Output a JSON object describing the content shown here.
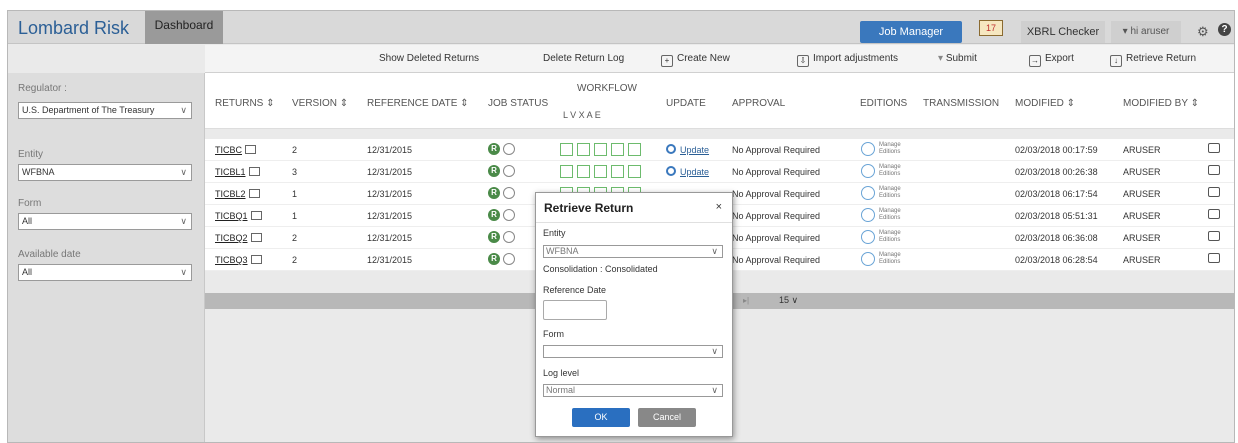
{
  "app": {
    "brand": "Lombard Risk",
    "dashboard_tab": "Dashboard"
  },
  "topbar": {
    "job_manager": "Job Manager",
    "calendar_badge": "17",
    "xbrl_checker": "XBRL Checker",
    "user": "hi aruser",
    "settings_icon": "gear-icon",
    "help_icon": "help-icon"
  },
  "toolbar": {
    "show_deleted": "Show Deleted Returns",
    "delete_log": "Delete Return Log",
    "create_new": "Create New",
    "import_adjustments": "Import adjustments",
    "submit": "Submit",
    "export": "Export",
    "retrieve_return": "Retrieve Return"
  },
  "sidebar": {
    "regulator_label": "Regulator :",
    "regulator_value": "U.S. Department of The Treasury",
    "entity_label": "Entity",
    "entity_value": "WFBNA",
    "form_label": "Form",
    "form_value": "All",
    "date_label": "Available date",
    "date_value": "All"
  },
  "table": {
    "headers": {
      "returns": "RETURNS ⇕",
      "version": "VERSION ⇕",
      "reference_date": "REFERENCE DATE ⇕",
      "job_status": "JOB STATUS",
      "workflow": "WORKFLOW",
      "workflow_sub": "L  V  X  A  E",
      "update": "UPDATE",
      "approval": "APPROVAL",
      "editions": "EDITIONS",
      "transmission": "TRANSMISSION",
      "modified": "MODIFIED ⇕",
      "modified_by": "MODIFIED BY ⇕"
    },
    "rows": [
      {
        "ret": "TICBC",
        "ver": "2",
        "date": "12/31/2015",
        "status": "R",
        "update": "Update",
        "approval": "No Approval Required",
        "ed1": "Manage",
        "ed2": "Editions",
        "mod": "02/03/2018 00:17:59",
        "by": "ARUSER"
      },
      {
        "ret": "TICBL1",
        "ver": "3",
        "date": "12/31/2015",
        "status": "R",
        "update": "Update",
        "approval": "No Approval Required",
        "ed1": "Manage",
        "ed2": "Editions",
        "mod": "02/03/2018 00:26:38",
        "by": "ARUSER"
      },
      {
        "ret": "TICBL2",
        "ver": "1",
        "date": "12/31/2015",
        "status": "R",
        "update": "",
        "approval": "No Approval Required",
        "ed1": "Manage",
        "ed2": "Editions",
        "mod": "02/03/2018 06:17:54",
        "by": "ARUSER"
      },
      {
        "ret": "TICBQ1",
        "ver": "1",
        "date": "12/31/2015",
        "status": "R",
        "update": "",
        "approval": "No Approval Required",
        "ed1": "Manage",
        "ed2": "Editions",
        "mod": "02/03/2018 05:51:31",
        "by": "ARUSER"
      },
      {
        "ret": "TICBQ2",
        "ver": "2",
        "date": "12/31/2015",
        "status": "R",
        "update": "",
        "approval": "No Approval Required",
        "ed1": "Manage",
        "ed2": "Editions",
        "mod": "02/03/2018 06:36:08",
        "by": "ARUSER"
      },
      {
        "ret": "TICBQ3",
        "ver": "2",
        "date": "12/31/2015",
        "status": "R",
        "update": "",
        "approval": "No Approval Required",
        "ed1": "Manage",
        "ed2": "Editions",
        "mod": "02/03/2018 06:28:54",
        "by": "ARUSER"
      }
    ]
  },
  "pager": {
    "page_size": "15"
  },
  "modal": {
    "title": "Retrieve Return",
    "close": "×",
    "entity_label": "Entity",
    "entity_value": "WFBNA",
    "consolidation": "Consolidation : Consolidated",
    "refdate_label": "Reference Date",
    "refdate_value": "",
    "form_label": "Form",
    "form_value": "",
    "loglevel_label": "Log level",
    "loglevel_value": "Normal",
    "ok": "OK",
    "cancel": "Cancel"
  }
}
